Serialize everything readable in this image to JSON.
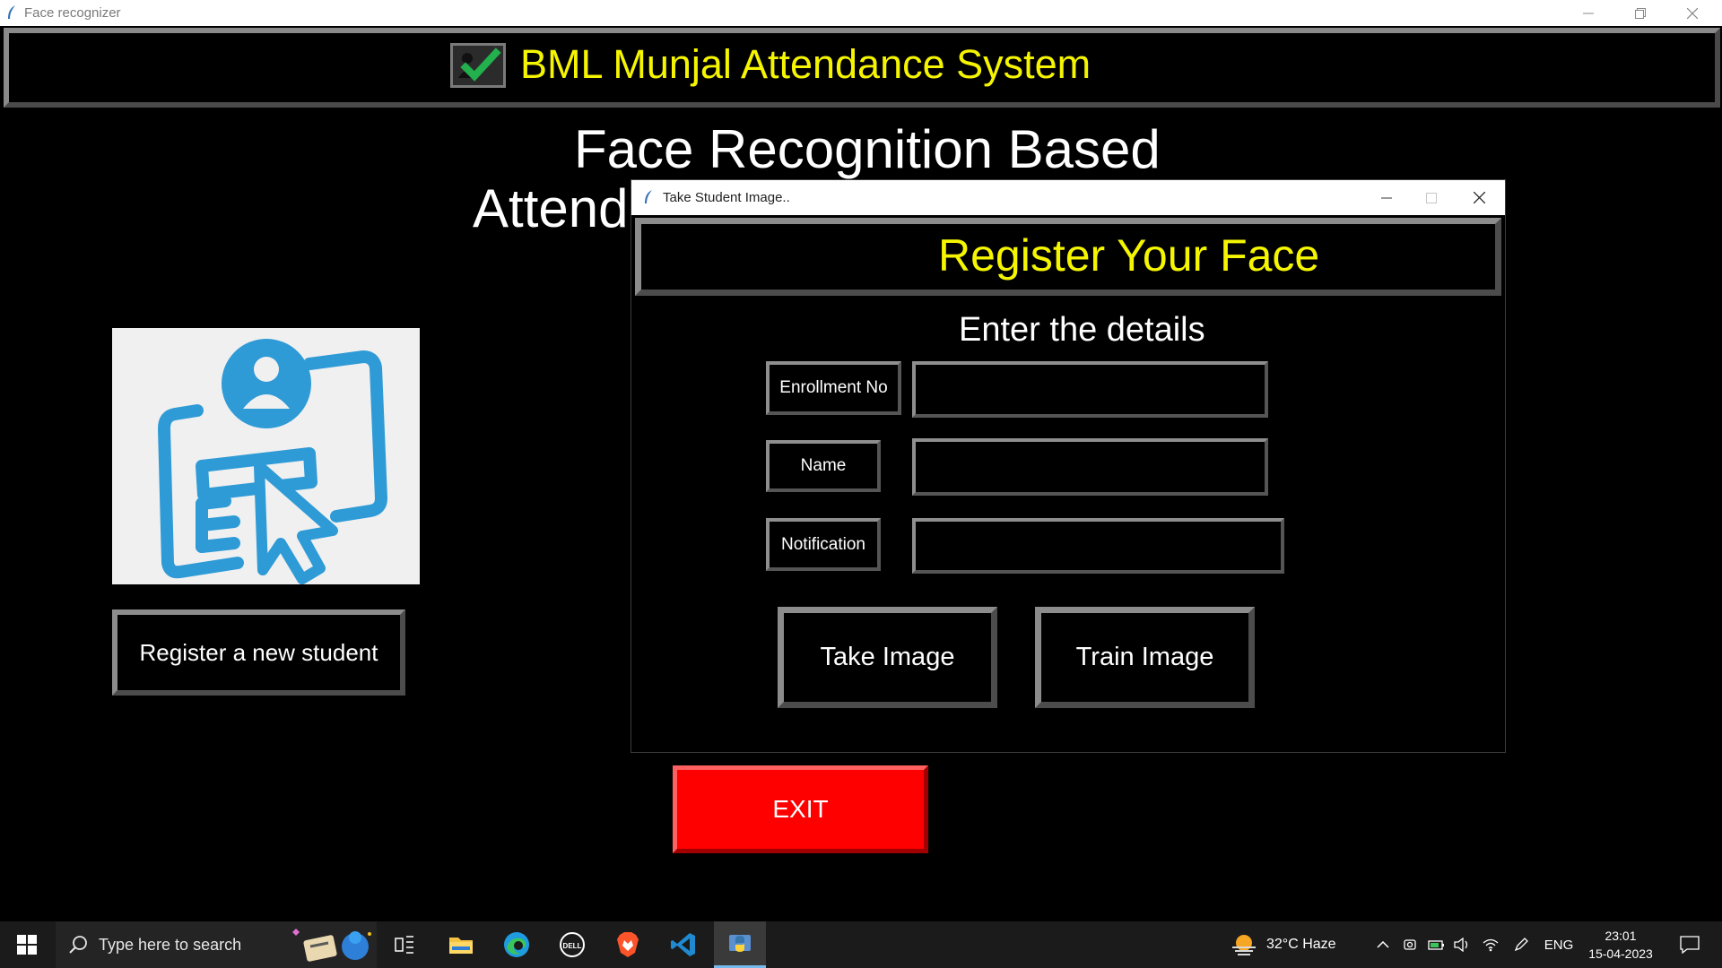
{
  "main_window": {
    "title": "Face recognizer"
  },
  "header": {
    "title": "BML Munjal Attendance System",
    "icon": "checkmark-icon"
  },
  "page": {
    "title_line1": "Face Recognition Based",
    "title_line2": "Attend"
  },
  "left_panel": {
    "image": "register-student-illustration",
    "register_button_label": "Register a new student"
  },
  "exit_button_label": "EXIT",
  "dialog": {
    "title": "Take Student Image..",
    "header": "Register Your Face",
    "subheading": "Enter the details",
    "fields": [
      {
        "label": "Enrollment No",
        "value": ""
      },
      {
        "label": "Name",
        "value": ""
      },
      {
        "label": "Notification",
        "value": ""
      }
    ],
    "take_image_label": "Take Image",
    "train_image_label": "Train Image"
  },
  "taskbar": {
    "search_placeholder": "Type here to search",
    "weather": "32°C  Haze",
    "language": "ENG",
    "time": "23:01",
    "date": "15-04-2023"
  },
  "colors": {
    "header_text": "#f5f500",
    "exit_button": "#ff0000",
    "background": "#000000",
    "illustration_blue": "#2f9bd6"
  }
}
